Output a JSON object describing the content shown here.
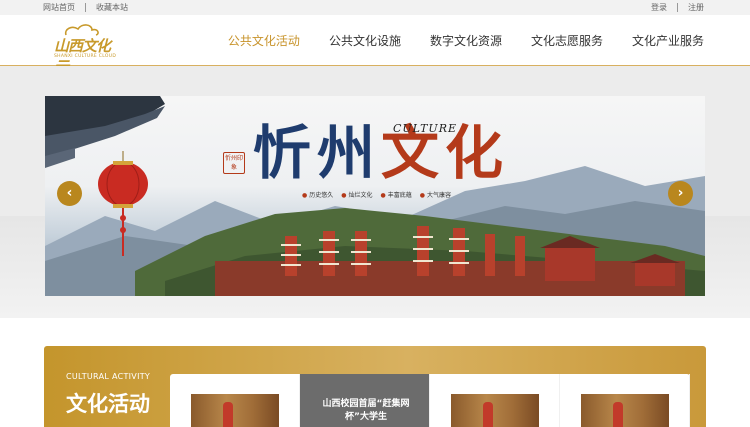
{
  "topbar": {
    "home": "网站首页",
    "bookmark": "收藏本站",
    "login": "登录",
    "register": "注册"
  },
  "logo": {
    "cn": "山西文化云",
    "en": "SHANXI CULTURE CLOUD"
  },
  "nav": {
    "items": [
      {
        "label": "公共文化活动",
        "active": true
      },
      {
        "label": "公共文化设施",
        "active": false
      },
      {
        "label": "数字文化资源",
        "active": false
      },
      {
        "label": "文化志愿服务",
        "active": false
      },
      {
        "label": "文化产业服务",
        "active": false
      }
    ]
  },
  "banner": {
    "title_part1": "忻州",
    "title_part2": "文化",
    "culture_word": "CULTURE",
    "seal_text": "忻州印象",
    "taglines": [
      "历史悠久",
      "灿烂文化",
      "丰富底蕴",
      "大气康容"
    ],
    "prev_icon": "‹",
    "next_icon": "›"
  },
  "activity": {
    "title_en": "CULTURAL ACTIVITY",
    "title_cn": "文化活动",
    "cards": [
      {
        "type": "image"
      },
      {
        "type": "caption",
        "caption": "山西校园首届“赶集网杯”大学生"
      },
      {
        "type": "image"
      },
      {
        "type": "image"
      }
    ]
  },
  "colors": {
    "accent": "#c8942c",
    "nav_active": "#c8942c",
    "arrow_bg": "#b9871e",
    "panel_gold": "#d8b160"
  }
}
